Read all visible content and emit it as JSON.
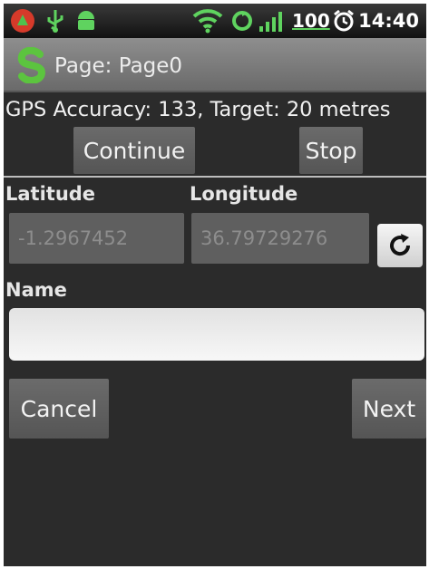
{
  "status_bar": {
    "battery": "100",
    "time": "14:40",
    "icons": [
      "app-notification-icon",
      "usb-icon",
      "android-debug-icon",
      "wifi-icon",
      "sync-icon",
      "signal-icon",
      "alarm-icon"
    ]
  },
  "title_bar": {
    "title": "Page: Page0",
    "icon": "app-logo-icon"
  },
  "gps": {
    "status_text": "GPS Accuracy: 133, Target: 20 metres"
  },
  "gps_buttons": {
    "continue_label": "Continue",
    "stop_label": "Stop"
  },
  "location": {
    "latitude_label": "Latitude",
    "longitude_label": "Longitude",
    "latitude_value": "-1.2967452",
    "longitude_value": "36.79729276",
    "refresh_icon": "refresh-icon"
  },
  "name_field": {
    "label": "Name",
    "value": ""
  },
  "nav": {
    "cancel_label": "Cancel",
    "next_label": "Next"
  },
  "colors": {
    "background": "#2b2b2b",
    "accent_green": "#5fd35f",
    "button": "#5f5f5f"
  }
}
